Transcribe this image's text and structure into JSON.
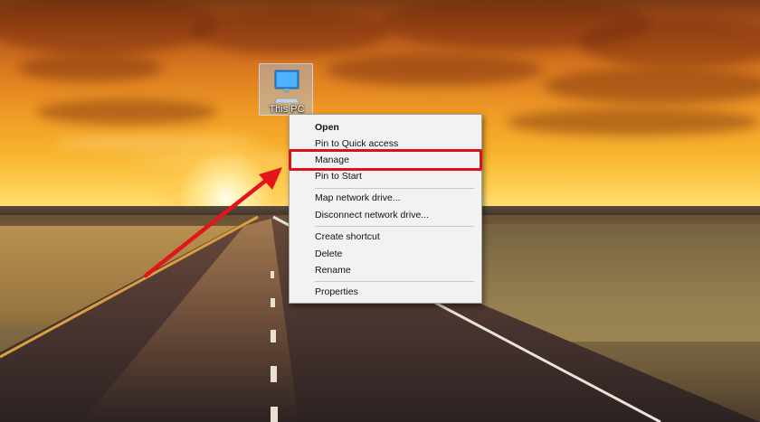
{
  "desktop": {
    "icon_label": "This PC",
    "icon_name": "computer-monitor-icon"
  },
  "context_menu": {
    "items": [
      {
        "label": "Open",
        "bold": true
      },
      {
        "label": "Pin to Quick access"
      },
      {
        "label": "Manage",
        "highlighted": true
      },
      {
        "label": "Pin to Start"
      },
      {
        "label": "Map network drive..."
      },
      {
        "label": "Disconnect network drive..."
      },
      {
        "label": "Create shortcut"
      },
      {
        "label": "Delete"
      },
      {
        "label": "Rename"
      },
      {
        "label": "Properties"
      }
    ]
  },
  "annotation": {
    "highlight_color": "#d4141c",
    "arrow_color": "#e3141c"
  }
}
